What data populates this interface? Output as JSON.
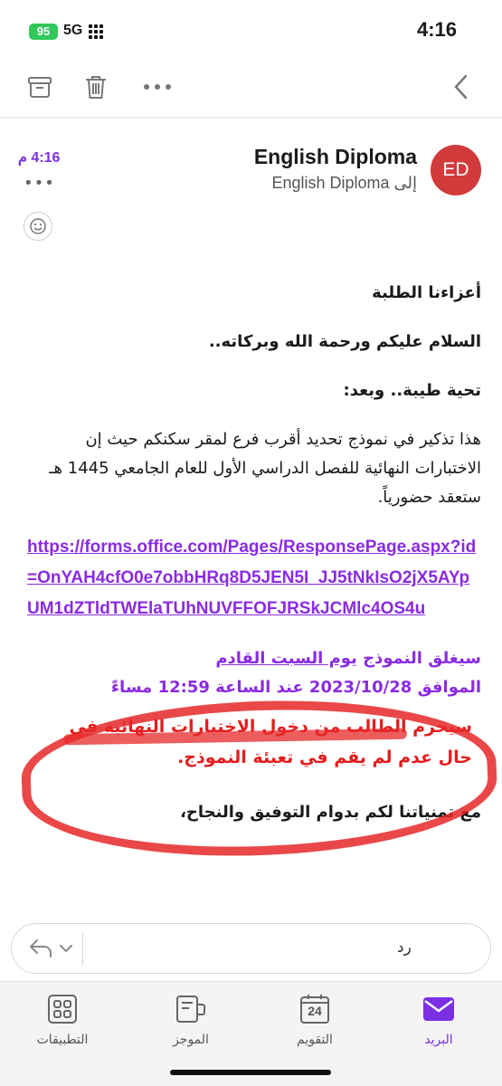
{
  "status_bar": {
    "battery": "95",
    "network": "5G",
    "time": "4:16"
  },
  "header": {
    "avatar_initials": "ED",
    "sender": "English Diploma",
    "recipient": "إلى English Diploma",
    "time": "4:16 م",
    "more": "•••"
  },
  "body": {
    "greeting": "أعزاءنا الطلبة",
    "salam": "السلام عليكم ورحمة الله وبركاته..",
    "tahiya": "تحية طيبة.. وبعد:",
    "paragraph": "هذا تذكير في نموذج تحديد أقرب فرع لمقر سكنكم حيث إن الاختبارات النهائية للفصل الدراسي الأول للعام الجامعي 1445 هـ ستعقد حضورياً.",
    "link": "https://forms.office.com/Pages/ResponsePage.aspx?id=OnYAH4cfO0e7obbHRq8D5JEN5I_JJ5tNkIsO2jX5AYpUM1dZTldTWElaTUhNUVFFOFJRSkJCMlc4OS4u",
    "close_notice_prefix": "سيغلق النموذج ",
    "close_notice_day": "يوم السبت القادم",
    "close_notice_date": "الموافق 2023/10/28 عند الساعة 12:59 مساءً",
    "warning": "سيحرم الطالب من دخول الاختبارات النهائية في حال عدم لم يقم في تعبئة النموذج.",
    "closing": "مع تمنياتنا لكم بدوام التوفيق والنجاح،"
  },
  "reply": {
    "placeholder": "رد"
  },
  "tabs": [
    {
      "label": "البريد",
      "icon": "mail-icon",
      "active": true
    },
    {
      "label": "التقويم",
      "icon": "calendar-icon",
      "day": "24"
    },
    {
      "label": "الموجز",
      "icon": "feed-icon"
    },
    {
      "label": "التطبيقات",
      "icon": "apps-icon"
    }
  ],
  "colors": {
    "accent": "#7b2fe3",
    "avatar": "#d13b3b",
    "warning": "#e31e1e",
    "link": "#8a2be2"
  }
}
